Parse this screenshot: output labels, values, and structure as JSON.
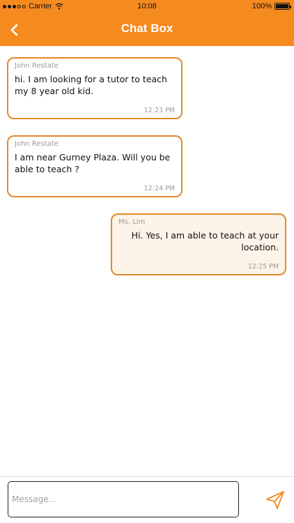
{
  "status_bar": {
    "carrier": "Carrier",
    "time": "10:08",
    "battery_percent": "100%",
    "battery_level": 1.0
  },
  "header": {
    "title": "Chat Box",
    "back_icon": "chevron-left-icon"
  },
  "messages": [
    {
      "sender": "John Restate",
      "text": "hi. I am looking for a tutor to teach my 8 year old kid.",
      "time": "12:23 PM",
      "direction": "incoming"
    },
    {
      "sender": "John Restate",
      "text": "I am near Gurney Plaza. Will you be able to teach ?",
      "time": "12:24 PM",
      "direction": "incoming"
    },
    {
      "sender": "Ms. Lim",
      "text": "Hi. Yes, I am able to teach at your location.",
      "time": "12:25 PM",
      "direction": "outgoing"
    }
  ],
  "composer": {
    "value": "",
    "placeholder": "Message...",
    "send_icon": "send-icon"
  },
  "colors": {
    "accent": "#f58a1f",
    "bubble_border": "#e1892a",
    "outgoing_bubble": "#fdf3e8",
    "meta_text": "#9a9a9a"
  }
}
